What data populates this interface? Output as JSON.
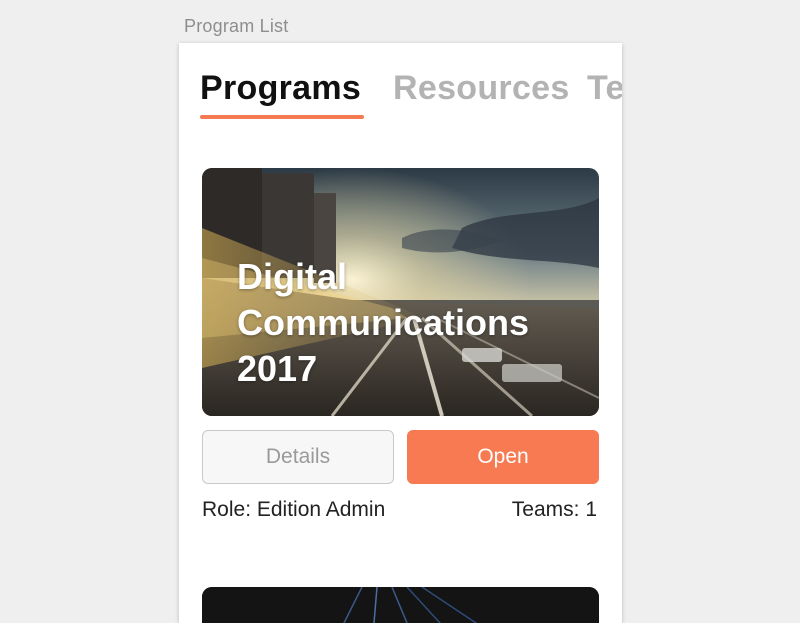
{
  "artboard": {
    "label": "Program List"
  },
  "tabs": [
    {
      "label": "Programs",
      "active": true
    },
    {
      "label": "Resources",
      "active": false
    },
    {
      "label": "Te",
      "active": false
    }
  ],
  "program_card": {
    "title": "Digital\nCommunications\n2017",
    "details_label": "Details",
    "open_label": "Open",
    "role": "Role: Edition Admin",
    "teams": "Teams: 1"
  },
  "colors": {
    "accent": "#f47b51",
    "tab_inactive": "#b3b3b3",
    "background": "#efefef"
  }
}
